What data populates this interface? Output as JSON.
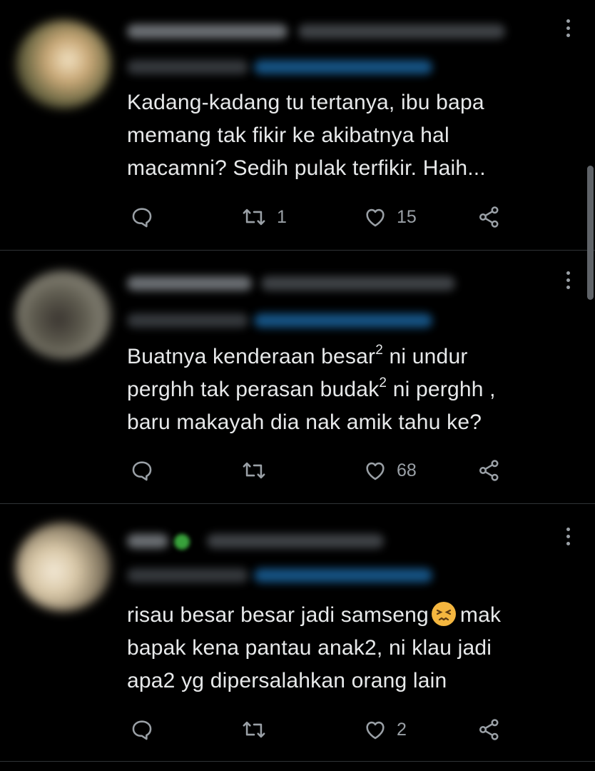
{
  "colors": {
    "background": "#000000",
    "text": "#e7e9ea",
    "muted": "#9aa0a6",
    "divider": "#2f3336",
    "link_blurred": "#1d6fb0"
  },
  "tweets": [
    {
      "text": "Kadang-kadang tu tertanya, ibu bapa memang tak fikir ke akibatnya hal macamni? Sedih pulak terfikir. Haih...",
      "lines": [
        "Kadang-kadang tu tertanya, ibu bapa",
        "memang tak fikir ke akibatnya hal",
        "macamni? Sedih pulak terfikir. Haih..."
      ],
      "reply_count": "",
      "retweet_count": "1",
      "like_count": "15",
      "icons": [
        "reply-icon",
        "retweet-icon",
        "like-icon",
        "share-icon",
        "more-icon"
      ]
    },
    {
      "lines": [
        {
          "before": "Buatnya kenderaan besar",
          "sup": "2",
          "after": " ni undur"
        },
        {
          "before": "perghh tak perasan budak",
          "sup": "2",
          "after": " ni perghh ,"
        },
        {
          "before": "baru makayah dia nak amik tahu ke?",
          "sup": "",
          "after": ""
        }
      ],
      "reply_count": "",
      "retweet_count": "",
      "like_count": "68",
      "icons": [
        "reply-icon",
        "retweet-icon",
        "like-icon",
        "share-icon",
        "more-icon"
      ]
    },
    {
      "lines": [
        {
          "before": "risau besar besar jadi samseng",
          "emoji": "persevering-face",
          "after": "mak"
        },
        {
          "before": "bapak kena pantau anak2, ni klau jadi"
        },
        {
          "before": "apa2 yg dipersalahkan orang lain"
        }
      ],
      "reply_count": "",
      "retweet_count": "",
      "like_count": "2",
      "icons": [
        "reply-icon",
        "retweet-icon",
        "like-icon",
        "share-icon",
        "more-icon"
      ]
    }
  ]
}
